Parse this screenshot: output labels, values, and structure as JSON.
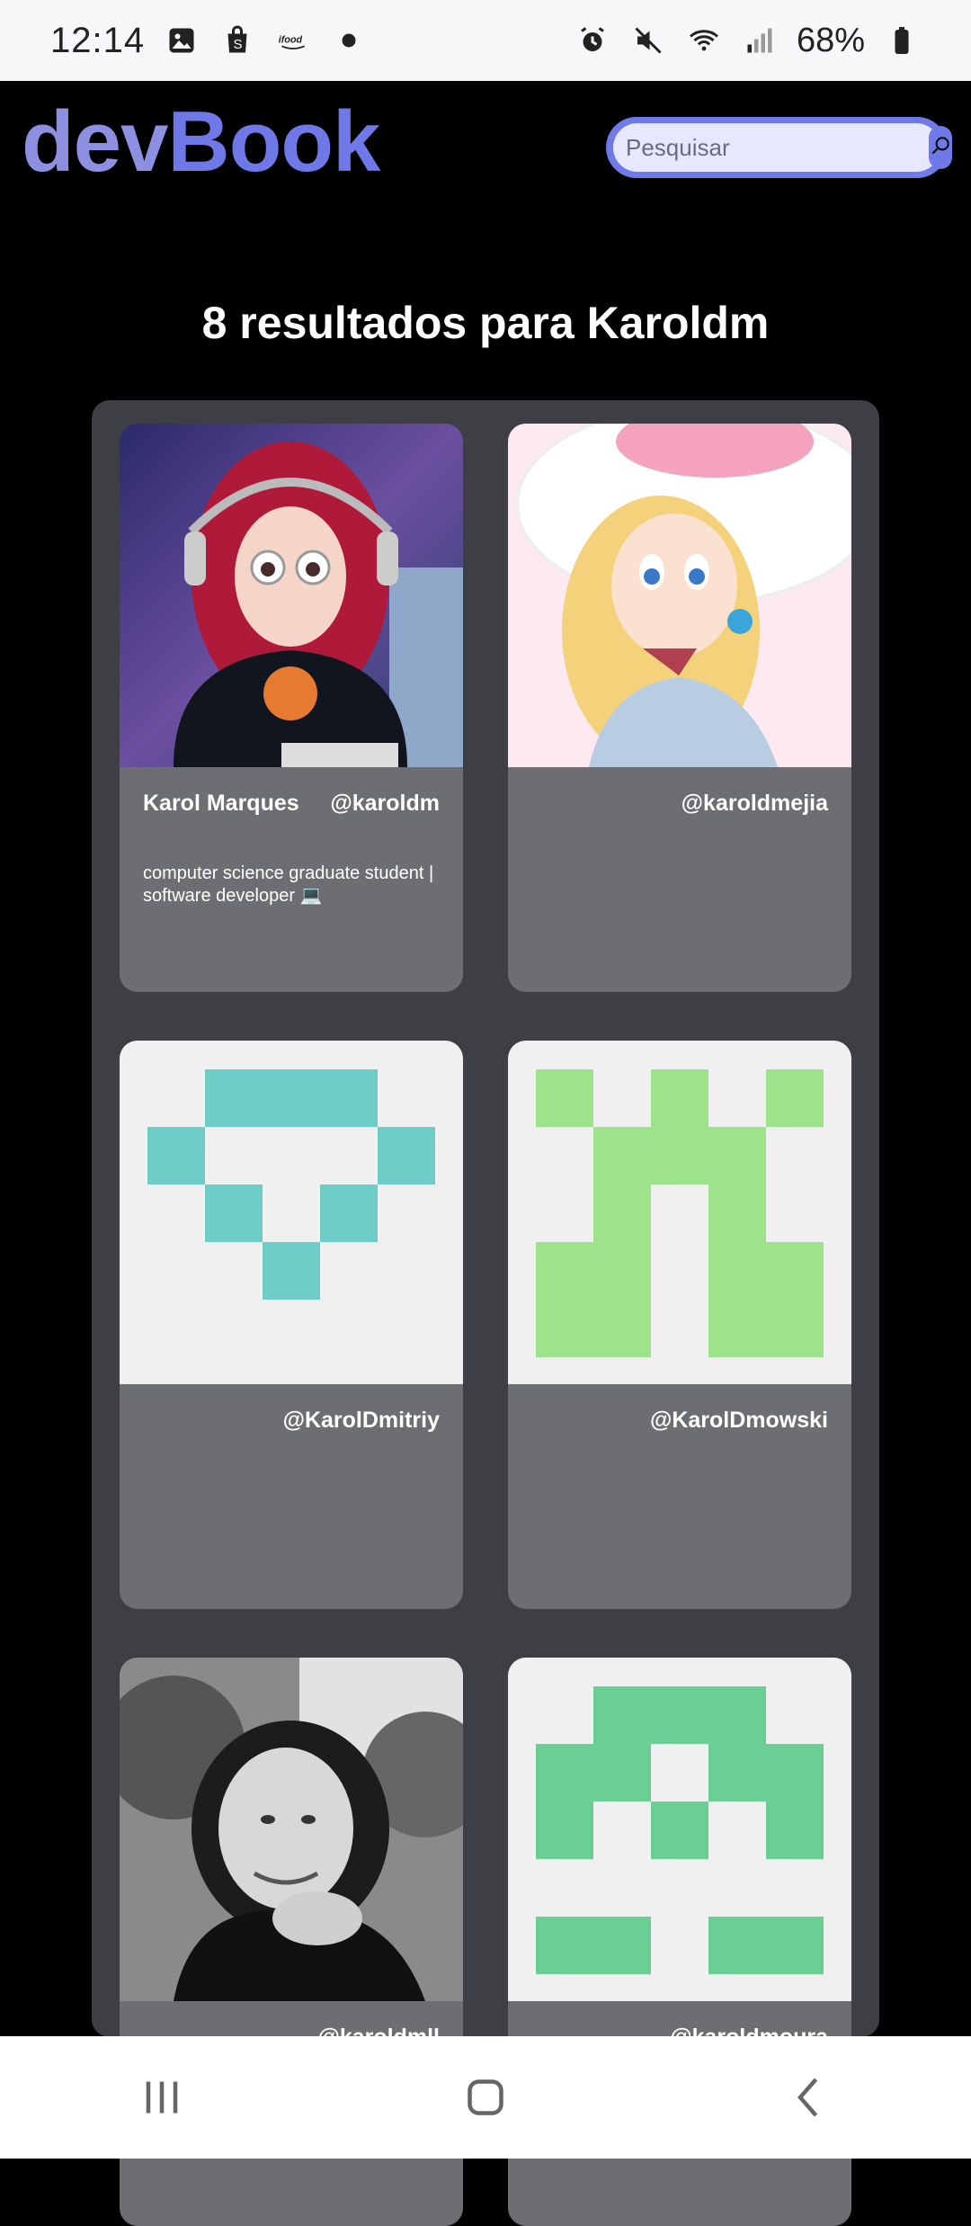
{
  "status": {
    "time": "12:14",
    "battery": "68%",
    "left_icons": [
      "gallery-icon",
      "shopping-bag-icon",
      "ifood-icon",
      "dot-icon"
    ],
    "right_icons": [
      "alarm-icon",
      "mute-icon",
      "wifi-icon",
      "signal-icon",
      "battery-icon"
    ],
    "ifood_label": "ifood"
  },
  "header": {
    "brand_part1": "dev",
    "brand_part2": "Book",
    "search_placeholder": "Pesquisar",
    "search_icon": "search-icon",
    "colors": {
      "brand1": "#8d8fe0",
      "brand2": "#6e78e6",
      "search": "#6f7ae8"
    }
  },
  "results": {
    "title": "8 resultados para Karoldm"
  },
  "cards": [
    {
      "name": "Karol Marques",
      "handle": "@karoldm",
      "bio": "computer science graduate student | software developer 💻",
      "image": "photo-anime-girl-headphones"
    },
    {
      "name": "",
      "handle": "@karoldmejia",
      "bio": "",
      "image": "photo-princess-peach"
    },
    {
      "name": "",
      "handle": "@KarolDmitriy",
      "bio": "",
      "image": "identicon-teal",
      "color": "#6ecdc6"
    },
    {
      "name": "",
      "handle": "@KarolDmowski",
      "bio": "",
      "image": "identicon-green",
      "color": "#9de38c"
    },
    {
      "name": "",
      "handle": "@karoldmll",
      "bio": "",
      "image": "photo-woman-bw"
    },
    {
      "name": "",
      "handle": "@karoldmoura",
      "bio": "",
      "image": "identicon-mint",
      "color": "#6acf94"
    }
  ],
  "nav": {
    "recent": "recent-apps-icon",
    "home": "home-icon",
    "back": "back-icon"
  }
}
